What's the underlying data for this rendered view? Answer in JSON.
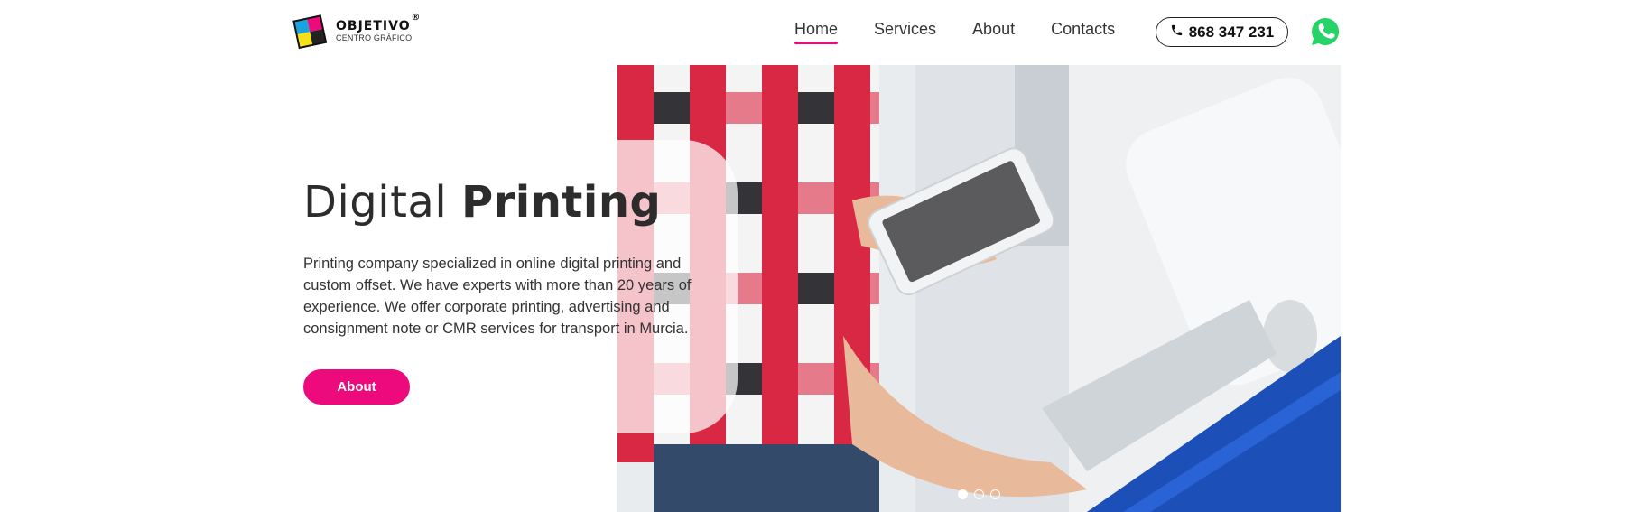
{
  "brand": {
    "name": "OBJETIVO",
    "registered": "®",
    "subtitle": "CENTRO GRÁFICO"
  },
  "nav": {
    "items": [
      {
        "label": "Home",
        "active": true
      },
      {
        "label": "Services",
        "active": false
      },
      {
        "label": "About",
        "active": false
      },
      {
        "label": "Contacts",
        "active": false
      }
    ]
  },
  "contact": {
    "phone": "868 347 231",
    "phone_icon": "phone-icon",
    "whatsapp_icon": "whatsapp-icon"
  },
  "hero": {
    "title_light": "Digital",
    "title_bold": "Printing",
    "description": "Printing company specialized in online digital printing and custom offset. We have experts with more than 20 years of experience. We offer corporate printing, advertising and consignment note or CMR services for transport in Murcia.",
    "cta_label": "About"
  },
  "slider": {
    "count": 3,
    "active_index": 0
  },
  "colors": {
    "accent": "#ec0a7c",
    "whatsapp": "#25d366"
  }
}
